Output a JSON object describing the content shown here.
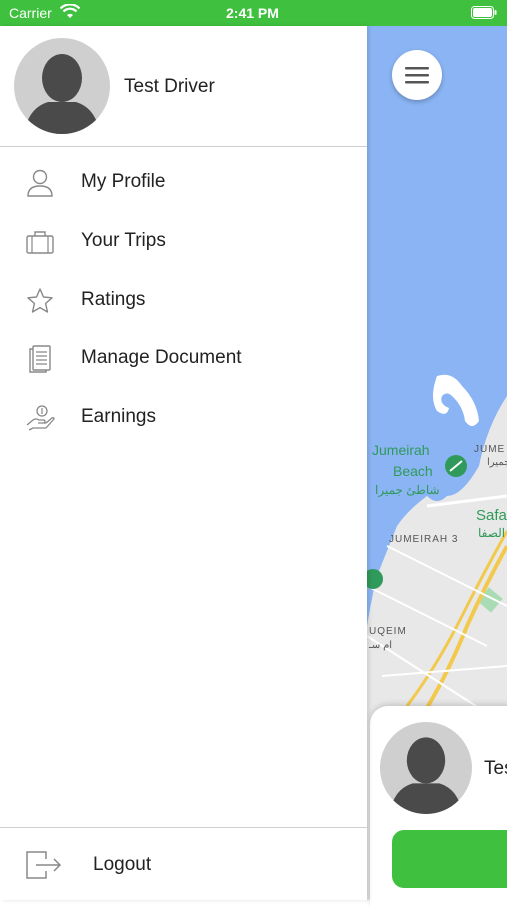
{
  "status_bar": {
    "carrier": "Carrier",
    "time": "2:41 PM"
  },
  "drawer": {
    "driver_name": "Test Driver",
    "menu": [
      {
        "label": "My Profile",
        "icon": "person-icon"
      },
      {
        "label": "Your Trips",
        "icon": "briefcase-icon"
      },
      {
        "label": "Ratings",
        "icon": "star-icon"
      },
      {
        "label": "Manage Document",
        "icon": "document-icon"
      },
      {
        "label": "Earnings",
        "icon": "earnings-hand-icon"
      }
    ],
    "logout_label": "Logout"
  },
  "map": {
    "labels": {
      "jumeirah_beach_1": "Jumeirah",
      "jumeirah_beach_2": "Beach",
      "jumeirah_beach_ar": "شاطئ جميرا",
      "jume": "JUME",
      "jume_ar": "جميرا",
      "safa": "Safa",
      "safa_ar": "الصفا",
      "jumeirah3": "JUMEIRAH 3",
      "uqeim": "UQEIM",
      "uqeim_ar": "ام سـ"
    },
    "water_color": "#8ab4f4",
    "land_color": "#e8e8e8"
  },
  "bottom_card": {
    "name": "Tes"
  },
  "colors": {
    "accent": "#3fc03f"
  }
}
